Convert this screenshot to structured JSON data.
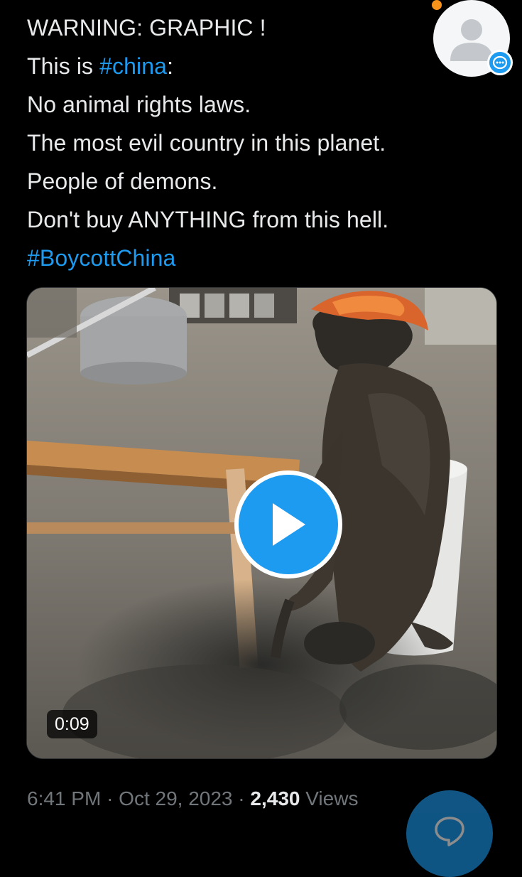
{
  "tweet": {
    "lines": [
      {
        "text": "WARNING: GRAPHIC !"
      },
      {
        "prefix": "This is ",
        "hashtag": "#china",
        "suffix": ":"
      },
      {
        "text": "No animal rights laws."
      },
      {
        "text": "The most evil country in this planet."
      },
      {
        "text": "People of demons."
      },
      {
        "text": "Don't buy ANYTHING from this hell."
      },
      {
        "hashtag": "#BoycottChina"
      }
    ]
  },
  "avatar": {
    "icon": "default-user-icon",
    "badge_icon": "message-bubble-icon"
  },
  "media": {
    "type": "video",
    "duration": "0:09",
    "play_icon": "play-icon"
  },
  "meta": {
    "time": "6:41 PM",
    "separator": "·",
    "date": "Oct 29, 2023",
    "views_count": "2,430",
    "views_label": "Views"
  },
  "compose_button": {
    "icon": "reply-bubble-icon"
  },
  "colors": {
    "background": "#000000",
    "text": "#e7e9ea",
    "accent": "#1d9bf0",
    "muted": "#71767b"
  }
}
